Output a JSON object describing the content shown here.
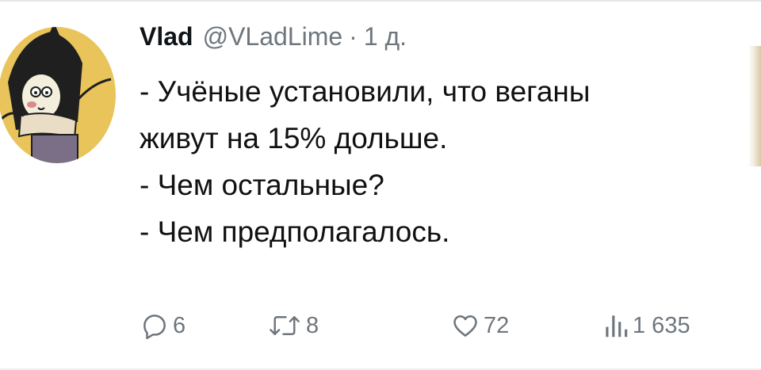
{
  "tweet": {
    "author_name": "Vlad",
    "handle": "@VLadLime",
    "separator": "·",
    "time": "1 д.",
    "lines": [
      "- Учёные установили, что веганы",
      "живут на 15% дольше.",
      "- Чем остальные?",
      "- Чем предполагалось."
    ]
  },
  "actions": {
    "reply": {
      "icon": "reply-icon",
      "count": "6"
    },
    "retweet": {
      "icon": "retweet-icon",
      "count": "8"
    },
    "like": {
      "icon": "heart-icon",
      "count": "72"
    },
    "views": {
      "icon": "views-icon",
      "count": "1 635"
    }
  },
  "colors": {
    "text_primary": "#0f1419",
    "text_secondary": "#6e767d",
    "avatar_background": "#e9c45a"
  }
}
